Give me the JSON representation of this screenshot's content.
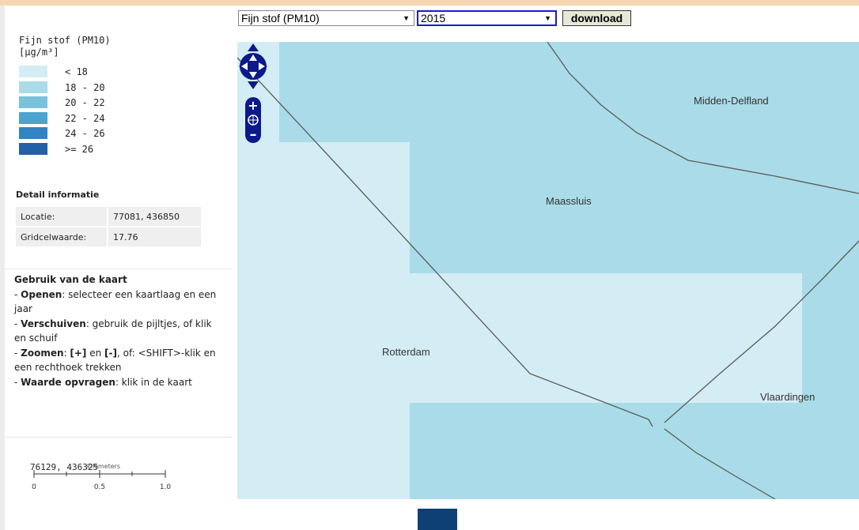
{
  "toolbar": {
    "layer_select": "Fijn stof (PM10)",
    "year_select": "2015",
    "download_label": "download"
  },
  "legend": {
    "title_line1": "Fijn stof (PM10)",
    "title_line2": "[µg/m³]",
    "classes": [
      {
        "label": "< 18",
        "color": "#d4edf5"
      },
      {
        "label": "18 - 20",
        "color": "#a9dce8"
      },
      {
        "label": "20 - 22",
        "color": "#78c2dc"
      },
      {
        "label": "22 - 24",
        "color": "#4ba3cf"
      },
      {
        "label": "24 - 26",
        "color": "#3283c1"
      },
      {
        "label": ">= 26",
        "color": "#2260a8"
      }
    ]
  },
  "detail": {
    "heading": "Detail informatie",
    "location_label": "Locatie:",
    "location_value": "77081, 436850",
    "grid_label": "Gridcelwaarde:",
    "grid_value": "17.76"
  },
  "usage": {
    "heading": "Gebruik van de kaart",
    "open_key": "Openen",
    "open_text": ": selecteer een kaartlaag en een jaar",
    "pan_key": "Verschuiven",
    "pan_text": ": gebruik de pijltjes, of klik en schuif",
    "zoom_key": "Zoomen",
    "zoom_plus": "[+]",
    "zoom_and": " en ",
    "zoom_minus": "[-]",
    "zoom_text": ", of: <SHIFT>-klik en een rechthoek trekken",
    "query_key": "Waarde opvragen",
    "query_text": ": klik in de kaart"
  },
  "mouse_position": "76129, 436325",
  "scale_bar": {
    "unit": "kilometers",
    "labels": [
      "0",
      "0.5",
      "1.0"
    ]
  },
  "map": {
    "places": [
      "Midden-Delfland",
      "Maassluis",
      "Rotterdam",
      "Vlaardingen"
    ],
    "cell_colors": {
      "low": "#d4edf5",
      "mid": "#a9dce8"
    }
  },
  "icons": {
    "pan": "pan-arrows-icon",
    "zoom_in": "plus-icon",
    "zoom_world": "globe-icon",
    "zoom_out": "minus-icon"
  }
}
